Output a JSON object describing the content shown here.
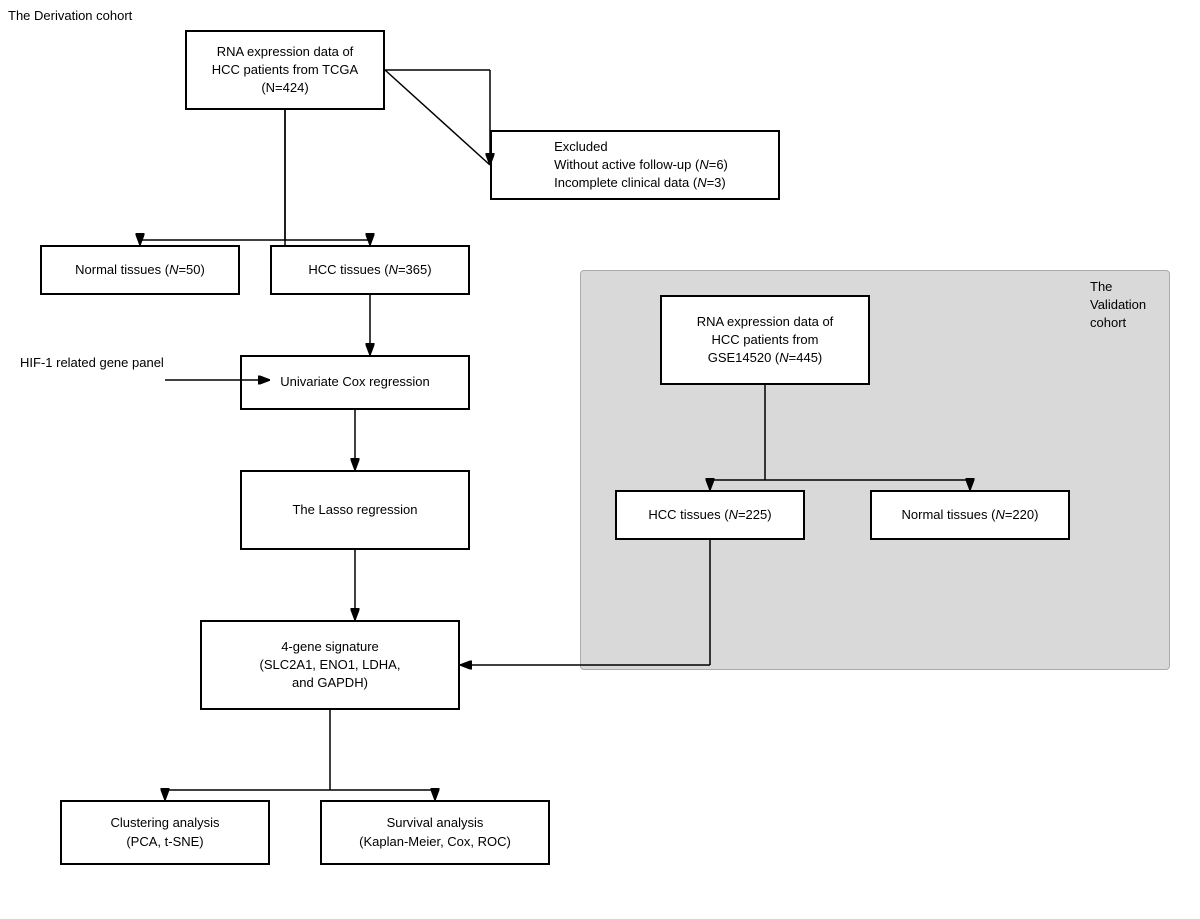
{
  "labels": {
    "derivation_cohort": "The Derivation cohort",
    "validation_cohort": "The Validation cohort"
  },
  "boxes": {
    "tcga": "RNA expression data of\nHCC patients from TCGA\n(N=424)",
    "excluded": "Excluded\nWithout active follow-up (N=6)\nIncomplete clinical data (N=3)",
    "normal_tissues_left": "Normal tissues (N=50)",
    "hcc_tissues_left": "HCC tissues (N=365)",
    "hif_panel": "HIF-1 related gene panel",
    "univariate_cox": "Univariate Cox regression",
    "lasso": "The Lasso regression",
    "four_gene": "4-gene signature\n(SLC2A1, ENO1, LDHA,\nand GAPDH)",
    "clustering": "Clustering analysis\n(PCA, t-SNE)",
    "survival": "Survival analysis\n(Kaplan-Meier, Cox, ROC)",
    "gse_tcga": "RNA expression data of\nHCC patients from\nGSE14520 (N=445)",
    "hcc_tissues_right": "HCC tissues (N=225)",
    "normal_tissues_right": "Normal tissues (N=220)"
  }
}
